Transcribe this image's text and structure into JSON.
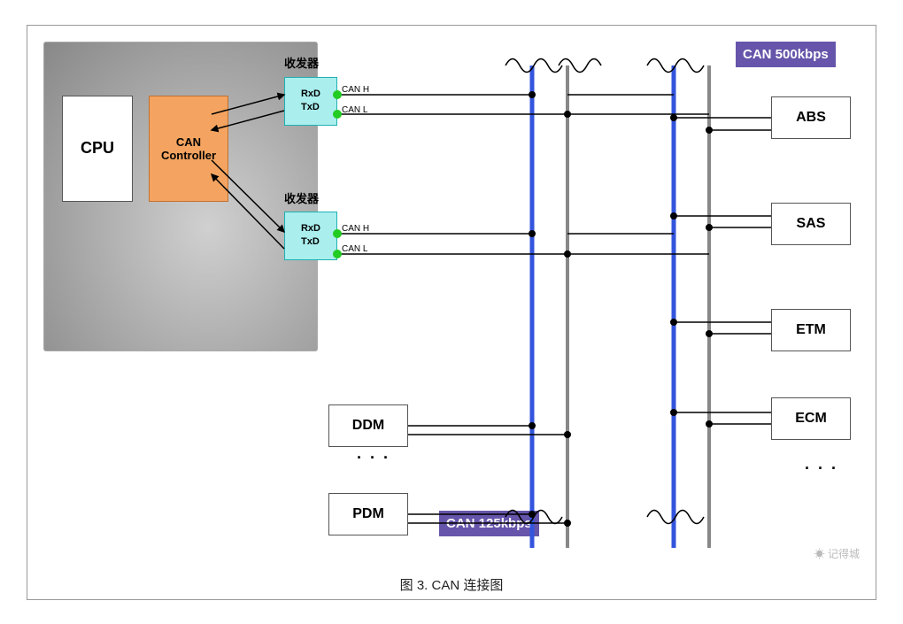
{
  "diagram": {
    "title": "图 3.   CAN 连接图",
    "cpu_label": "CPU",
    "can_controller_label": "CAN\nController",
    "transceiver1_label": "收发器",
    "transceiver2_label": "收发器",
    "transceiver_inner1": "RxD\nTxD",
    "transceiver_inner2": "RxD\nTxD",
    "canh_label": "CAN H",
    "canl_label": "CAN L",
    "canh2_label": "CAN H",
    "canl2_label": "CAN L",
    "can_500kbps": "CAN\n500kbps",
    "can_125kbps": "CAN\n125kbps",
    "ddm_label": "DDM",
    "pdm_label": "PDM",
    "abs_label": "ABS",
    "sas_label": "SAS",
    "etm_label": "ETM",
    "ecm_label": "ECM",
    "dots": "·  ·  ·",
    "watermark": "记得城"
  }
}
